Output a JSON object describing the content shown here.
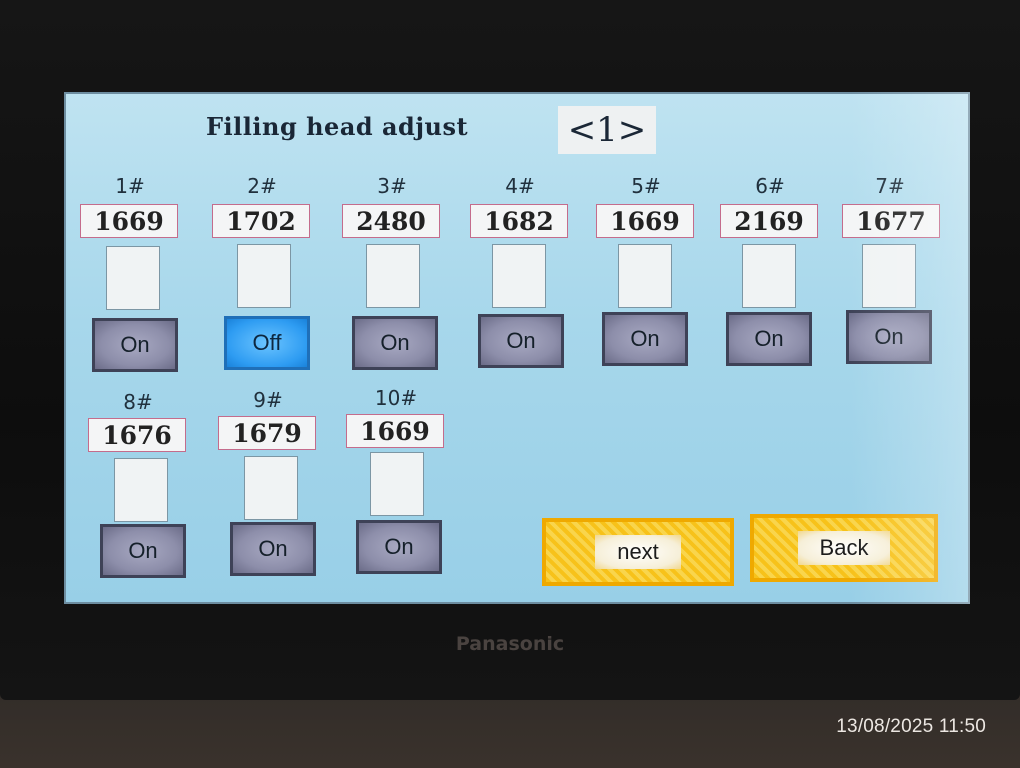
{
  "device": {
    "brand": "Panasonic"
  },
  "photo_timestamp": "13/08/2025 11:50",
  "screen": {
    "title": "Filling head adjust",
    "page_indicator": "<1>",
    "heads": [
      {
        "label": "1#",
        "value": "1669",
        "state": "On"
      },
      {
        "label": "2#",
        "value": "1702",
        "state": "Off"
      },
      {
        "label": "3#",
        "value": "2480",
        "state": "On"
      },
      {
        "label": "4#",
        "value": "1682",
        "state": "On"
      },
      {
        "label": "5#",
        "value": "1669",
        "state": "On"
      },
      {
        "label": "6#",
        "value": "2169",
        "state": "On"
      },
      {
        "label": "7#",
        "value": "1677",
        "state": "On"
      },
      {
        "label": "8#",
        "value": "1676",
        "state": "On"
      },
      {
        "label": "9#",
        "value": "1679",
        "state": "On"
      },
      {
        "label": "10#",
        "value": "1669",
        "state": "On"
      }
    ],
    "next_label": "next",
    "back_label": "Back"
  },
  "colors": {
    "screen_bg": "#a7d7eb",
    "toggle_on": "#8d8eaa",
    "toggle_off": "#2e9cf2",
    "nav_button": "#f7c21a"
  }
}
